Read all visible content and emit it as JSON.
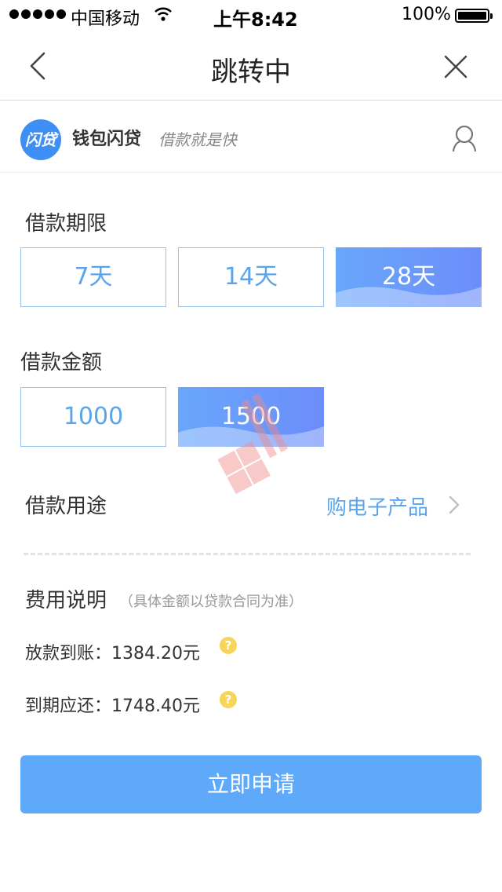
{
  "status_bar": {
    "carrier": "中国移动",
    "time": "上午8:42",
    "battery": "100%"
  },
  "nav": {
    "title": "跳转中"
  },
  "brand": {
    "logo_text": "闪贷",
    "name": "钱包闪贷",
    "slogan": "借款就是快"
  },
  "term": {
    "label": "借款期限",
    "options": [
      {
        "label": "7天",
        "selected": false
      },
      {
        "label": "14天",
        "selected": false
      },
      {
        "label": "28天",
        "selected": true
      }
    ]
  },
  "amount": {
    "label": "借款金额",
    "options": [
      {
        "label": "1000",
        "selected": false
      },
      {
        "label": "1500",
        "selected": true
      }
    ]
  },
  "purpose": {
    "label": "借款用途",
    "value": "购电子产品"
  },
  "fee": {
    "title": "费用说明",
    "note": "（具体金额以贷款合同为准）",
    "disbursement_label": "放款到账：",
    "disbursement_value": "1384.20元",
    "repayment_label": "到期应还：",
    "repayment_value": "1748.40元",
    "help_glyph": "?"
  },
  "apply_button": "立即申请",
  "colors": {
    "accent": "#5aa4ea",
    "button": "#5fa9fb",
    "selected_from": "#69a7fb",
    "selected_to": "#6c8dfb",
    "help": "#f6d65a"
  }
}
